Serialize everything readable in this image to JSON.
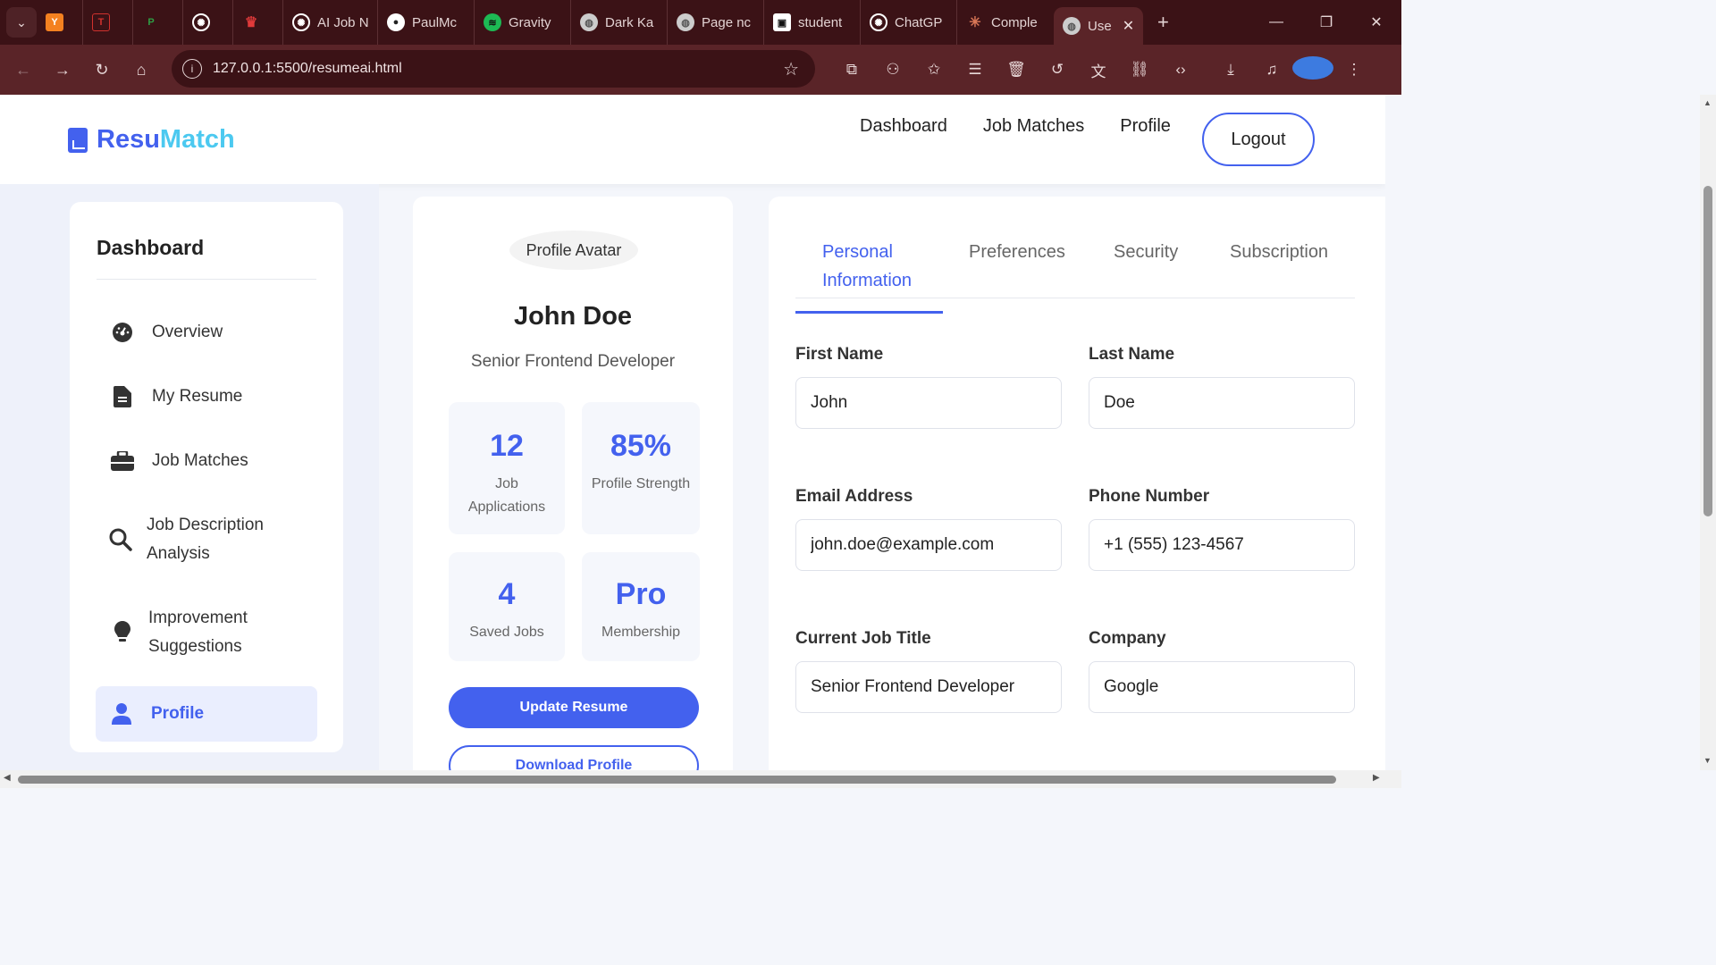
{
  "browser": {
    "tabs": [
      {
        "label": "",
        "favicon": "Y",
        "color": "#f48120"
      },
      {
        "label": "",
        "favicon": "T",
        "color": "#d0312d"
      },
      {
        "label": "",
        "favicon": "P",
        "color": "#2e9e44"
      },
      {
        "label": "",
        "favicon": "openai-icon",
        "color": "#ffffff"
      },
      {
        "label": "",
        "favicon": "crown-icon",
        "color": "#e03a3a"
      },
      {
        "label": "AI Job N",
        "favicon": "openai-icon",
        "color": "#ffffff"
      },
      {
        "label": "PaulMc",
        "favicon": "github-icon",
        "color": "#ffffff"
      },
      {
        "label": "Gravity",
        "favicon": "spotify-icon",
        "color": "#1db954"
      },
      {
        "label": "Dark Ka",
        "favicon": "globe-icon",
        "color": "#cccccc"
      },
      {
        "label": "Page nc",
        "favicon": "globe-icon",
        "color": "#cccccc"
      },
      {
        "label": "student",
        "favicon": "student-icon",
        "color": "#ffffff"
      },
      {
        "label": "ChatGP",
        "favicon": "openai-icon",
        "color": "#ffffff"
      },
      {
        "label": "Comple",
        "favicon": "claude-icon",
        "color": "#d97757"
      },
      {
        "label": "Use",
        "favicon": "globe-icon",
        "color": "#cccccc"
      }
    ],
    "url": "127.0.0.1:5500/resumeai.html"
  },
  "header": {
    "brand_part1": "Resu",
    "brand_part2": "Match",
    "nav": [
      "Dashboard",
      "Job Matches",
      "Profile"
    ],
    "logout": "Logout"
  },
  "sidebar": {
    "title": "Dashboard",
    "items": [
      {
        "label": "Overview",
        "icon": "gauge-icon"
      },
      {
        "label": "My Resume",
        "icon": "file-icon"
      },
      {
        "label": "Job Matches",
        "icon": "briefcase-icon"
      },
      {
        "label": "Job Description Analysis",
        "icon": "search-icon"
      },
      {
        "label": "Improvement Suggestions",
        "icon": "lightbulb-icon"
      },
      {
        "label": "Profile",
        "icon": "user-icon"
      }
    ]
  },
  "profile_card": {
    "avatar_alt": "Profile Avatar",
    "name": "John Doe",
    "title": "Senior Frontend Developer",
    "stats": [
      {
        "value": "12",
        "label": "Job Applications"
      },
      {
        "value": "85%",
        "label": "Profile Strength"
      },
      {
        "value": "4",
        "label": "Saved Jobs"
      },
      {
        "value": "Pro",
        "label": "Membership"
      }
    ],
    "update_button": "Update Resume",
    "download_button": "Download Profile"
  },
  "form": {
    "tabs": [
      "Personal Information",
      "Preferences",
      "Security",
      "Subscription"
    ],
    "fields": {
      "first_name": {
        "label": "First Name",
        "value": "John"
      },
      "last_name": {
        "label": "Last Name",
        "value": "Doe"
      },
      "email": {
        "label": "Email Address",
        "value": "john.doe@example.com"
      },
      "phone": {
        "label": "Phone Number",
        "value": "+1 (555) 123-4567"
      },
      "job_title": {
        "label": "Current Job Title",
        "value": "Senior Frontend Developer"
      },
      "company": {
        "label": "Company",
        "value": "Google"
      }
    }
  },
  "colors": {
    "accent": "#4361ee",
    "accent_light": "#4cc9f0",
    "browser_frame": "#5a2428"
  }
}
